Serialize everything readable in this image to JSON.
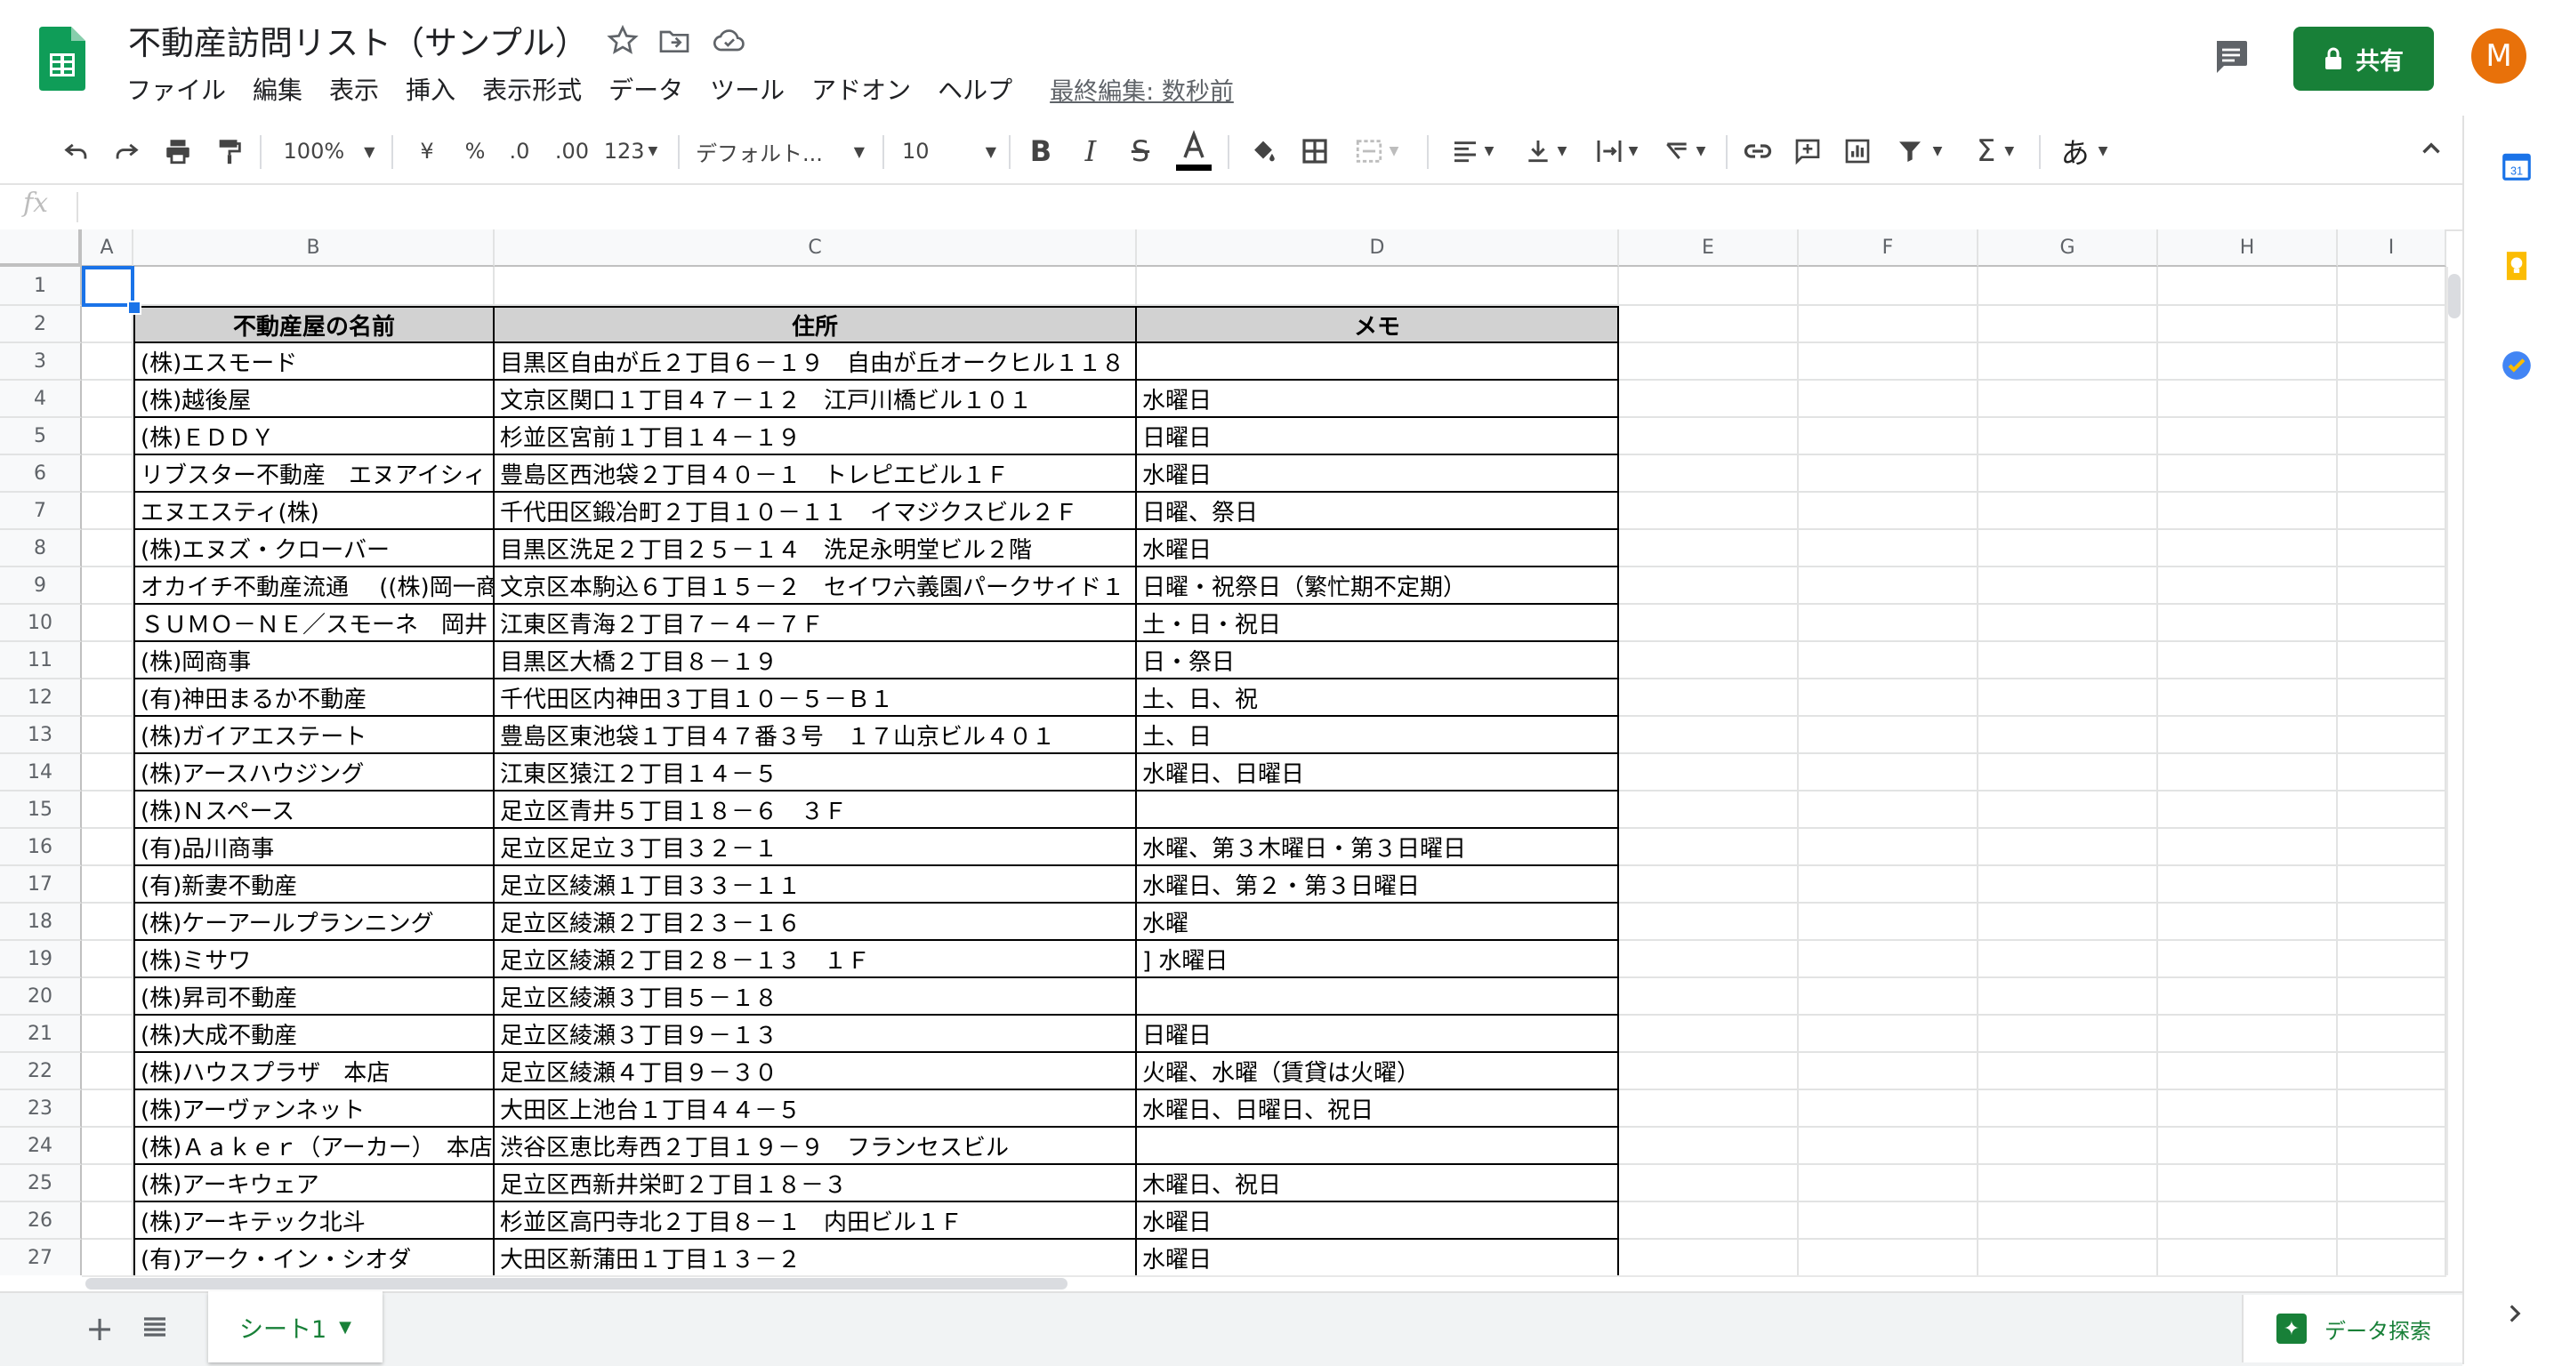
{
  "app": {
    "title": "不動産訪問リスト（サンプル）",
    "last_edit": "最終編集: 数秒前",
    "share_label": "共有",
    "avatar_letter": "M",
    "accent": "#188038"
  },
  "menu": [
    "ファイル",
    "編集",
    "表示",
    "挿入",
    "表示形式",
    "データ",
    "ツール",
    "アドオン",
    "ヘルプ"
  ],
  "toolbar": {
    "zoom": "100%",
    "currency": "¥",
    "percent": "%",
    "dec_decrease": ".0",
    "dec_increase": ".00",
    "number_format": "123",
    "font": "デフォルト...",
    "font_size": "10",
    "input_tools": "あ"
  },
  "formula_bar": {
    "fx": "fx",
    "value": ""
  },
  "columns": [
    "A",
    "B",
    "C",
    "D",
    "E",
    "F",
    "G",
    "H",
    "I"
  ],
  "table": {
    "headers": [
      "不動産屋の名前",
      "住所",
      "メモ"
    ],
    "rows": [
      [
        "(株)エスモード",
        "目黒区自由が丘２丁目６－１９　自由が丘オークヒル１１８",
        ""
      ],
      [
        "(株)越後屋",
        "文京区関口１丁目４７－１２　江戸川橋ビル１０１",
        "水曜日"
      ],
      [
        "(株)ＥＤＤＹ",
        "杉並区宮前１丁目１４－１９",
        "日曜日"
      ],
      [
        "リブスター不動産　エヌアイシィ",
        "豊島区西池袋２丁目４０－１　トレピエビル１Ｆ",
        " 水曜日"
      ],
      [
        "エヌエスティ(株)",
        "千代田区鍛冶町２丁目１０－１１　イマジクスビル２Ｆ",
        " 日曜、祭日"
      ],
      [
        "(株)エヌズ・クローバー",
        "目黒区洗足２丁目２５－１４　洗足永明堂ビル２階",
        "水曜日"
      ],
      [
        "オカイチ不動産流通　 ((株)岡一商",
        "文京区本駒込６丁目１５－２　セイワ六義園パークサイド１",
        "日曜・祝祭日（繁忙期不定期）"
      ],
      [
        "ＳＵＭＯ－ＮＥ／スモーネ　岡井",
        "江東区青海２丁目７－４－７Ｆ",
        " 土・日・祝日"
      ],
      [
        "(株)岡商事",
        "目黒区大橋２丁目８－１９",
        "日・祭日"
      ],
      [
        "(有)神田まるか不動産",
        "千代田区内神田３丁目１０－５－Ｂ１",
        " 土、日、祝"
      ],
      [
        "(株)ガイアエステート",
        "豊島区東池袋１丁目４７番３号　１７山京ビル４０１",
        "土、日"
      ],
      [
        "(株)アースハウジング",
        "江東区猿江２丁目１４－５",
        "水曜日、日曜日"
      ],
      [
        "(株)Ｎスペース",
        "足立区青井５丁目１８－６　３Ｆ",
        ""
      ],
      [
        "(有)品川商事",
        "足立区足立３丁目３２－１",
        " 水曜、第３木曜日・第３日曜日"
      ],
      [
        "(有)新妻不動産",
        "足立区綾瀬１丁目３３－１１",
        " 水曜日、第２・第３日曜日"
      ],
      [
        "(株)ケーアールプランニング",
        "足立区綾瀬２丁目２３－１６",
        " 水曜"
      ],
      [
        "(株)ミサワ",
        "足立区綾瀬２丁目２８－１３　１Ｆ",
        "] 水曜日"
      ],
      [
        "(株)昇司不動産",
        "足立区綾瀬３丁目５－１８",
        ""
      ],
      [
        "(株)大成不動産",
        "足立区綾瀬３丁目９－１３",
        "日曜日"
      ],
      [
        "(株)ハウスプラザ　本店",
        "足立区綾瀬４丁目９－３０",
        "火曜、水曜（賃貸は火曜）"
      ],
      [
        "(株)アーヴァンネット",
        "大田区上池台１丁目４４－５",
        "水曜日、日曜日、祝日"
      ],
      [
        "(株)Ａａｋｅｒ（アーカー）　本店",
        "渋谷区恵比寿西２丁目１９－９　フランセスビル",
        ""
      ],
      [
        "(株)アーキウェア",
        "足立区西新井栄町２丁目１８－３",
        "木曜日、祝日"
      ],
      [
        "(株)アーキテック北斗",
        "杉並区高円寺北２丁目８－１　内田ビル１Ｆ",
        "水曜日"
      ],
      [
        "(有)アーク・イン・シオダ",
        "大田区新蒲田１丁目１３－２",
        " 水曜日"
      ]
    ]
  },
  "sheet_tab": "シート1",
  "explore_label": "データ探索",
  "side_icons": [
    "calendar-icon",
    "keep-icon",
    "tasks-icon"
  ]
}
